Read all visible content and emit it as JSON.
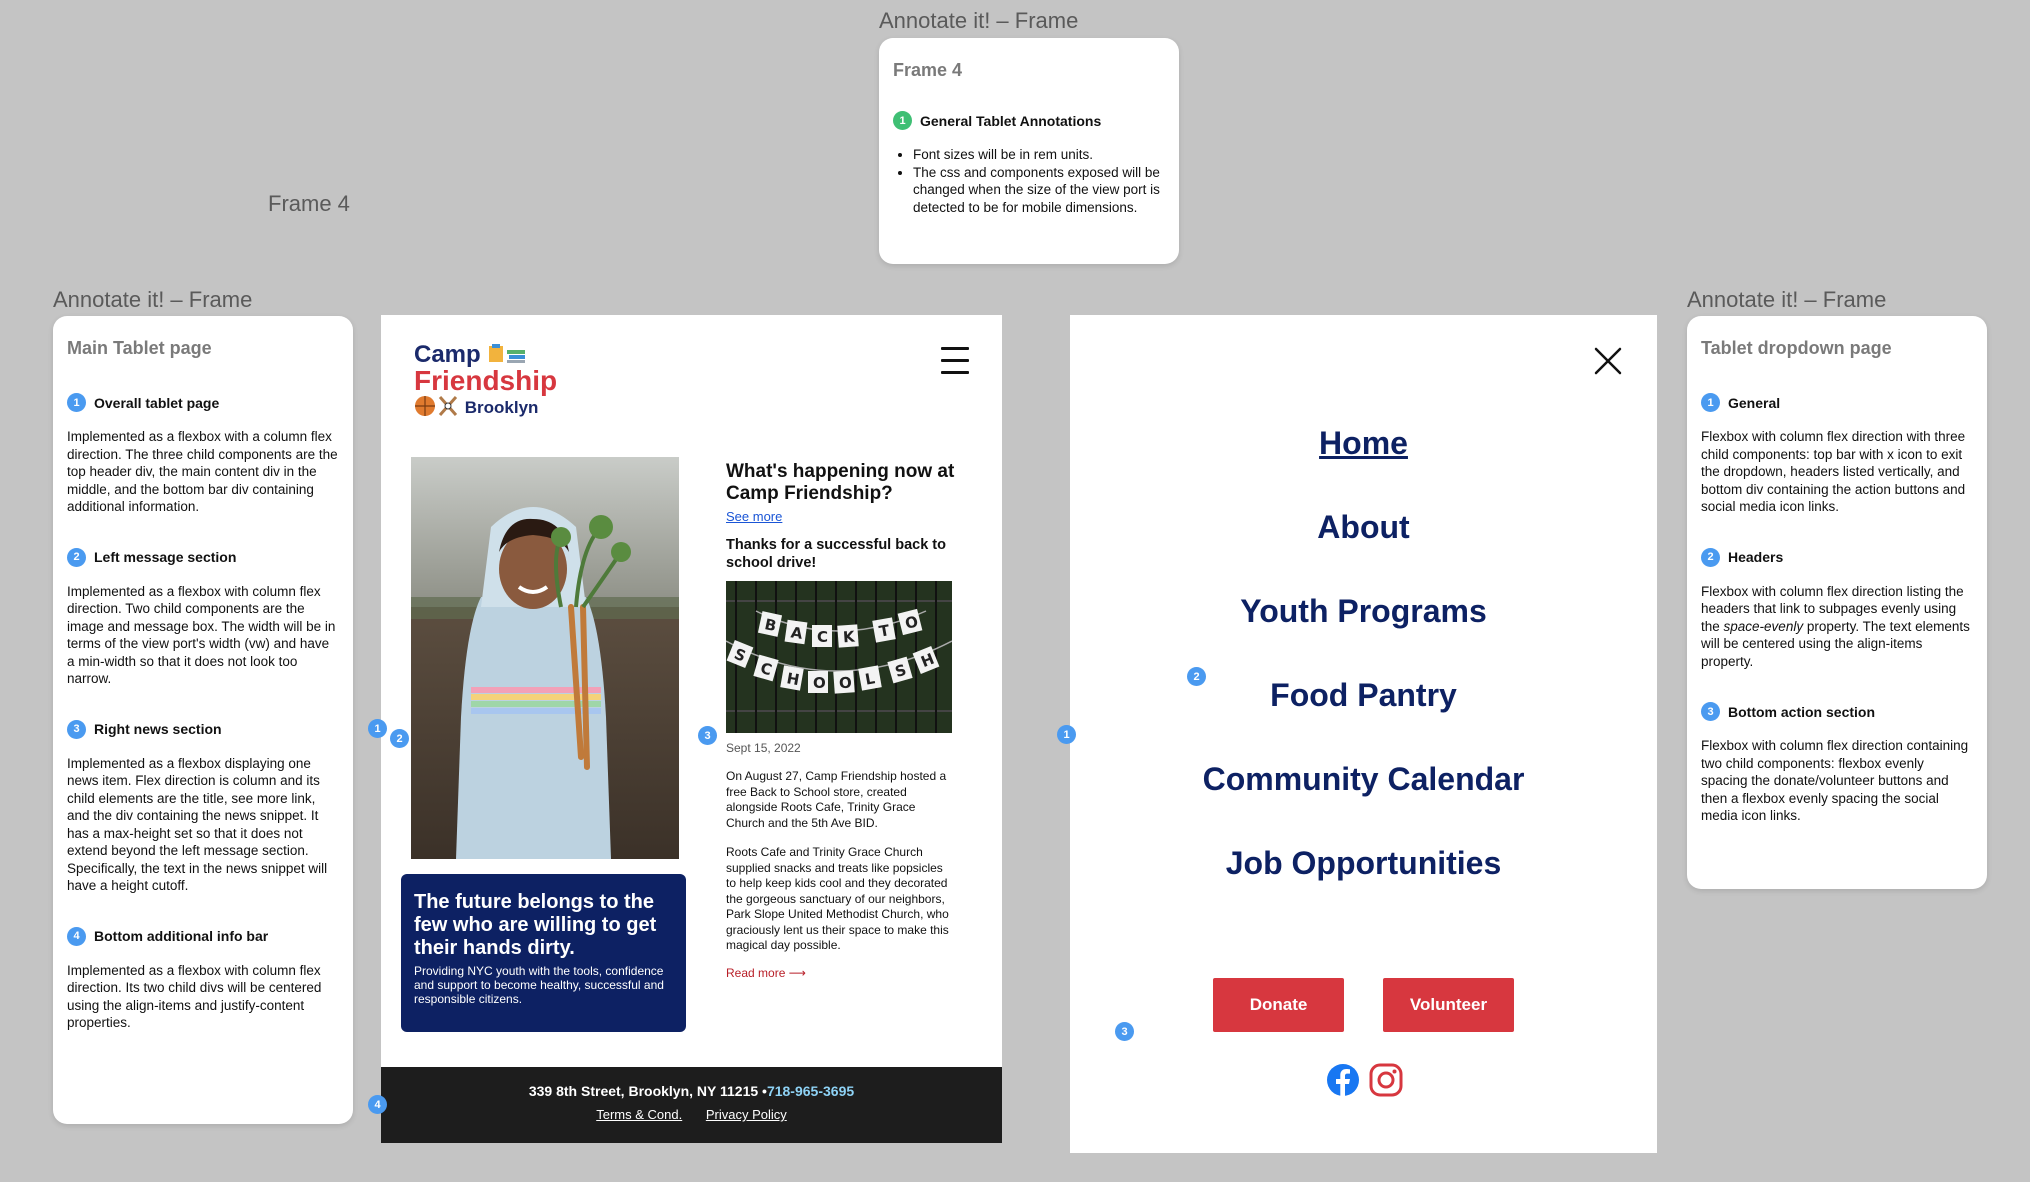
{
  "frame_labels": {
    "top_annotation": "Annotate it! – Frame",
    "left_annotation": "Annotate it! – Frame",
    "right_annotation": "Annotate it! – Frame",
    "frame_name": "Frame 4"
  },
  "general_card": {
    "title": "Frame 4",
    "item_title": "General Tablet Annotations",
    "bullets": [
      "Font sizes will be in rem units.",
      "The css and components exposed will be changed when the size of the view port is detected to be for mobile dimensions."
    ]
  },
  "main_card": {
    "title": "Main Tablet page",
    "items": [
      {
        "num": "1",
        "title": "Overall tablet page",
        "body": "Implemented as a flexbox with a column flex direction. The three child components are the top header div, the main content div in the middle, and the bottom bar div containing additional information."
      },
      {
        "num": "2",
        "title": "Left message section",
        "body": "Implemented as a flexbox with column flex direction. Two child components are the image and message box. The width will be in terms of the view port's width (vw) and have a min-width so that it does not look too narrow."
      },
      {
        "num": "3",
        "title": "Right news section",
        "body": "Implemented as a flexbox displaying one news item. Flex direction is column and its child elements are the title, see more link, and the div containing the news snippet. It has a max-height set so that it does not extend beyond the left message section. Specifically, the text in the news snippet will have a height cutoff."
      },
      {
        "num": "4",
        "title": "Bottom additional info bar",
        "body": "Implemented as a flexbox with column flex direction. Its two child divs will be centered using the align-items and justify-content properties."
      }
    ]
  },
  "dropdown_card": {
    "title": "Tablet dropdown page",
    "items": [
      {
        "num": "1",
        "title": "General",
        "body": "Flexbox with column flex direction with three child components: top bar with x icon to exit the dropdown, headers listed vertically, and bottom div containing the action buttons and social media icon links."
      },
      {
        "num": "2",
        "title": "Headers",
        "body_pre": "Flexbox with column flex direction listing the headers that link to subpages evenly using the ",
        "body_em": "space-evenly",
        "body_post": " property. The text elements will be centered using the align-items property."
      },
      {
        "num": "3",
        "title": "Bottom action section",
        "body": "Flexbox with column flex direction containing two child components: flexbox evenly spacing the donate/volunteer buttons and then a flexbox evenly spacing the social media icon links."
      }
    ]
  },
  "markers": {
    "m1": "1",
    "m2": "2",
    "m3": "3",
    "m4": "4"
  },
  "tablet": {
    "logo": {
      "line1": "Camp",
      "line2": "Friendship",
      "line3": "Brooklyn"
    },
    "message": {
      "title": "The future belongs to the few who are willing to get their hands dirty.",
      "subtitle": "Providing NYC youth with the tools, confidence and support to become healthy, successful and responsible citizens."
    },
    "news": {
      "title": "What's happening now at Camp Friendship?",
      "see_more": "See more",
      "subtitle": "Thanks for a successful back to school drive!",
      "banner_text": "BACK TO SCHOOL SHOP",
      "date": "Sept 15, 2022",
      "p1": "On August 27, Camp Friendship hosted a free Back to School store, created alongside Roots Cafe, Trinity Grace Church and the 5th Ave BID.",
      "p2": "Roots Cafe and Trinity Grace Church supplied snacks and treats like popsicles to help keep kids cool and they decorated the gorgeous sanctuary of our neighbors, Park Slope United Methodist Church, who graciously lent us their space to make this magical day possible.",
      "read_more": "Read more ⟶"
    },
    "footer": {
      "address": "339 8th Street, Brooklyn, NY 11215 •",
      "phone": "718-965-3695",
      "terms": "Terms & Cond.",
      "privacy": "Privacy Policy"
    }
  },
  "dropdown": {
    "menu": [
      "Home",
      "About",
      "Youth Programs",
      "Food Pantry",
      "Community Calendar",
      "Job Opportunities"
    ],
    "donate": "Donate",
    "volunteer": "Volunteer",
    "icons": [
      "close-icon",
      "hamburger-menu-icon",
      "facebook-icon",
      "instagram-icon"
    ]
  },
  "colors": {
    "navy": "#0d2163",
    "red": "#d7373f",
    "marker_blue": "#4a9af0",
    "marker_green": "#3fbf74",
    "footer_bg": "#1d1d1d",
    "canvas_bg": "#c4c4c4"
  }
}
